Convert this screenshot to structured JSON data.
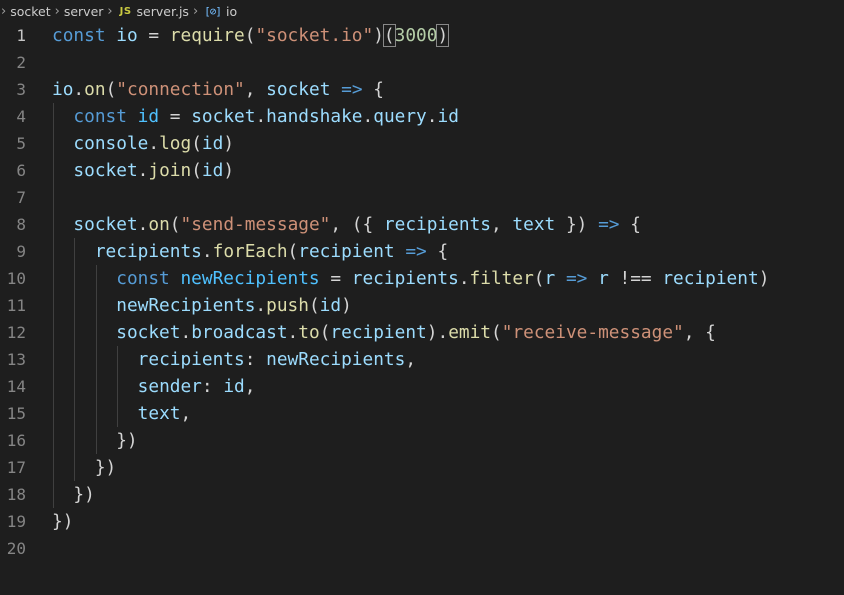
{
  "breadcrumb": {
    "folder1": "socket",
    "folder2": "server",
    "file_badge": "JS",
    "file": "server.js",
    "symbol_icon": "[⊘]",
    "symbol": "io"
  },
  "editor": {
    "line_numbers": [
      "1",
      "2",
      "3",
      "4",
      "5",
      "6",
      "7",
      "8",
      "9",
      "10",
      "11",
      "12",
      "13",
      "14",
      "15",
      "16",
      "17",
      "18",
      "19",
      "20"
    ],
    "lines": [
      [
        [
          "kw",
          "const "
        ],
        [
          "var",
          "io"
        ],
        [
          "op",
          " = "
        ],
        [
          "fn",
          "require"
        ],
        [
          "p",
          "("
        ],
        [
          "str",
          "\"socket.io\""
        ],
        [
          "p",
          ")"
        ],
        [
          "pm",
          "("
        ],
        [
          "num",
          "3000"
        ],
        [
          "pm",
          ")"
        ]
      ],
      [],
      [
        [
          "var",
          "io"
        ],
        [
          "p",
          "."
        ],
        [
          "fn",
          "on"
        ],
        [
          "p",
          "("
        ],
        [
          "str",
          "\"connection\""
        ],
        [
          "p",
          ", "
        ],
        [
          "var",
          "socket"
        ],
        [
          "op",
          " "
        ],
        [
          "arrow",
          "=>"
        ],
        [
          "p",
          " {"
        ]
      ],
      [
        [
          "p",
          "  "
        ],
        [
          "kw",
          "const "
        ],
        [
          "cst",
          "id"
        ],
        [
          "op",
          " = "
        ],
        [
          "var",
          "socket"
        ],
        [
          "p",
          "."
        ],
        [
          "var",
          "handshake"
        ],
        [
          "p",
          "."
        ],
        [
          "var",
          "query"
        ],
        [
          "p",
          "."
        ],
        [
          "var",
          "id"
        ]
      ],
      [
        [
          "p",
          "  "
        ],
        [
          "var",
          "console"
        ],
        [
          "p",
          "."
        ],
        [
          "fn",
          "log"
        ],
        [
          "p",
          "("
        ],
        [
          "var",
          "id"
        ],
        [
          "p",
          ")"
        ]
      ],
      [
        [
          "p",
          "  "
        ],
        [
          "var",
          "socket"
        ],
        [
          "p",
          "."
        ],
        [
          "fn",
          "join"
        ],
        [
          "p",
          "("
        ],
        [
          "var",
          "id"
        ],
        [
          "p",
          ")"
        ]
      ],
      [],
      [
        [
          "p",
          "  "
        ],
        [
          "var",
          "socket"
        ],
        [
          "p",
          "."
        ],
        [
          "fn",
          "on"
        ],
        [
          "p",
          "("
        ],
        [
          "str",
          "\"send-message\""
        ],
        [
          "p",
          ", ({ "
        ],
        [
          "var",
          "recipients"
        ],
        [
          "p",
          ", "
        ],
        [
          "var",
          "text"
        ],
        [
          "p",
          " }) "
        ],
        [
          "arrow",
          "=>"
        ],
        [
          "p",
          " {"
        ]
      ],
      [
        [
          "p",
          "    "
        ],
        [
          "var",
          "recipients"
        ],
        [
          "p",
          "."
        ],
        [
          "fn",
          "forEach"
        ],
        [
          "p",
          "("
        ],
        [
          "var",
          "recipient"
        ],
        [
          "op",
          " "
        ],
        [
          "arrow",
          "=>"
        ],
        [
          "p",
          " {"
        ]
      ],
      [
        [
          "p",
          "      "
        ],
        [
          "kw",
          "const "
        ],
        [
          "cst",
          "newRecipients"
        ],
        [
          "op",
          " = "
        ],
        [
          "var",
          "recipients"
        ],
        [
          "p",
          "."
        ],
        [
          "fn",
          "filter"
        ],
        [
          "p",
          "("
        ],
        [
          "var",
          "r"
        ],
        [
          "op",
          " "
        ],
        [
          "arrow",
          "=>"
        ],
        [
          "op",
          " "
        ],
        [
          "var",
          "r"
        ],
        [
          "op",
          " !== "
        ],
        [
          "var",
          "recipient"
        ],
        [
          "p",
          ")"
        ]
      ],
      [
        [
          "p",
          "      "
        ],
        [
          "var",
          "newRecipients"
        ],
        [
          "p",
          "."
        ],
        [
          "fn",
          "push"
        ],
        [
          "p",
          "("
        ],
        [
          "var",
          "id"
        ],
        [
          "p",
          ")"
        ]
      ],
      [
        [
          "p",
          "      "
        ],
        [
          "var",
          "socket"
        ],
        [
          "p",
          "."
        ],
        [
          "var",
          "broadcast"
        ],
        [
          "p",
          "."
        ],
        [
          "fn",
          "to"
        ],
        [
          "p",
          "("
        ],
        [
          "var",
          "recipient"
        ],
        [
          "p",
          ")."
        ],
        [
          "fn",
          "emit"
        ],
        [
          "p",
          "("
        ],
        [
          "str",
          "\"receive-message\""
        ],
        [
          "p",
          ", {"
        ]
      ],
      [
        [
          "p",
          "        "
        ],
        [
          "var",
          "recipients"
        ],
        [
          "p",
          ": "
        ],
        [
          "var",
          "newRecipients"
        ],
        [
          "p",
          ","
        ]
      ],
      [
        [
          "p",
          "        "
        ],
        [
          "var",
          "sender"
        ],
        [
          "p",
          ": "
        ],
        [
          "var",
          "id"
        ],
        [
          "p",
          ","
        ]
      ],
      [
        [
          "p",
          "        "
        ],
        [
          "var",
          "text"
        ],
        [
          "p",
          ","
        ]
      ],
      [
        [
          "p",
          "      })"
        ]
      ],
      [
        [
          "p",
          "    })"
        ]
      ],
      [
        [
          "p",
          "  })"
        ]
      ],
      [
        [
          "p",
          "})"
        ]
      ],
      []
    ]
  },
  "colors": {
    "background": "#1e1e1e",
    "keyword": "#569cd6",
    "variable": "#9cdcfe",
    "function": "#dcdcaa",
    "string": "#ce9178",
    "number": "#b5cea8",
    "constant": "#4fc1ff",
    "line_number": "#858585"
  }
}
